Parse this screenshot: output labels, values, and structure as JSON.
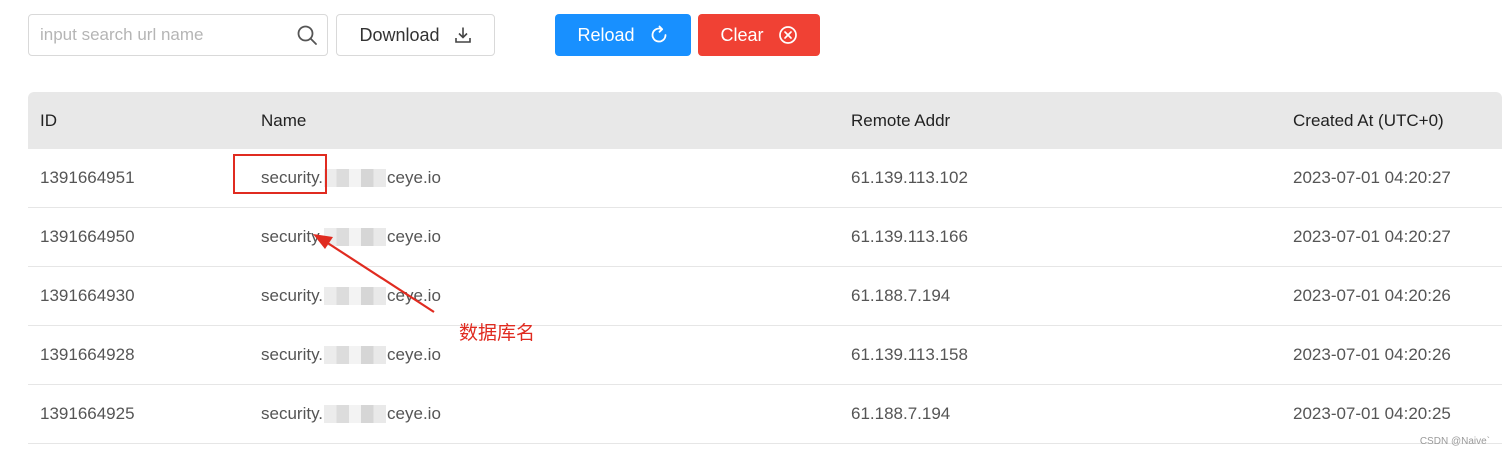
{
  "toolbar": {
    "search_placeholder": "input search url name",
    "download_label": "Download",
    "reload_label": "Reload",
    "clear_label": "Clear"
  },
  "colors": {
    "reload_bg": "#1890ff",
    "clear_bg": "#f04134",
    "annotation": "#e02b20"
  },
  "table": {
    "headers": [
      "ID",
      "Name",
      "Remote Addr",
      "Created At (UTC+0)"
    ],
    "rows": [
      {
        "id": "1391664951",
        "name_prefix": "security.",
        "name_suffix": "ceye.io",
        "addr": "61.139.113.102",
        "created": "2023-07-01 04:20:27"
      },
      {
        "id": "1391664950",
        "name_prefix": "security.",
        "name_suffix": "ceye.io",
        "addr": "61.139.113.166",
        "created": "2023-07-01 04:20:27"
      },
      {
        "id": "1391664930",
        "name_prefix": "security.",
        "name_suffix": "ceye.io",
        "addr": "61.188.7.194",
        "created": "2023-07-01 04:20:26"
      },
      {
        "id": "1391664928",
        "name_prefix": "security.",
        "name_suffix": "ceye.io",
        "addr": "61.139.113.158",
        "created": "2023-07-01 04:20:26"
      },
      {
        "id": "1391664925",
        "name_prefix": "security.",
        "name_suffix": "ceye.io",
        "addr": "61.188.7.194",
        "created": "2023-07-01 04:20:25"
      }
    ]
  },
  "annotation": {
    "text": "数据库名"
  },
  "watermark": "CSDN @Naive`"
}
